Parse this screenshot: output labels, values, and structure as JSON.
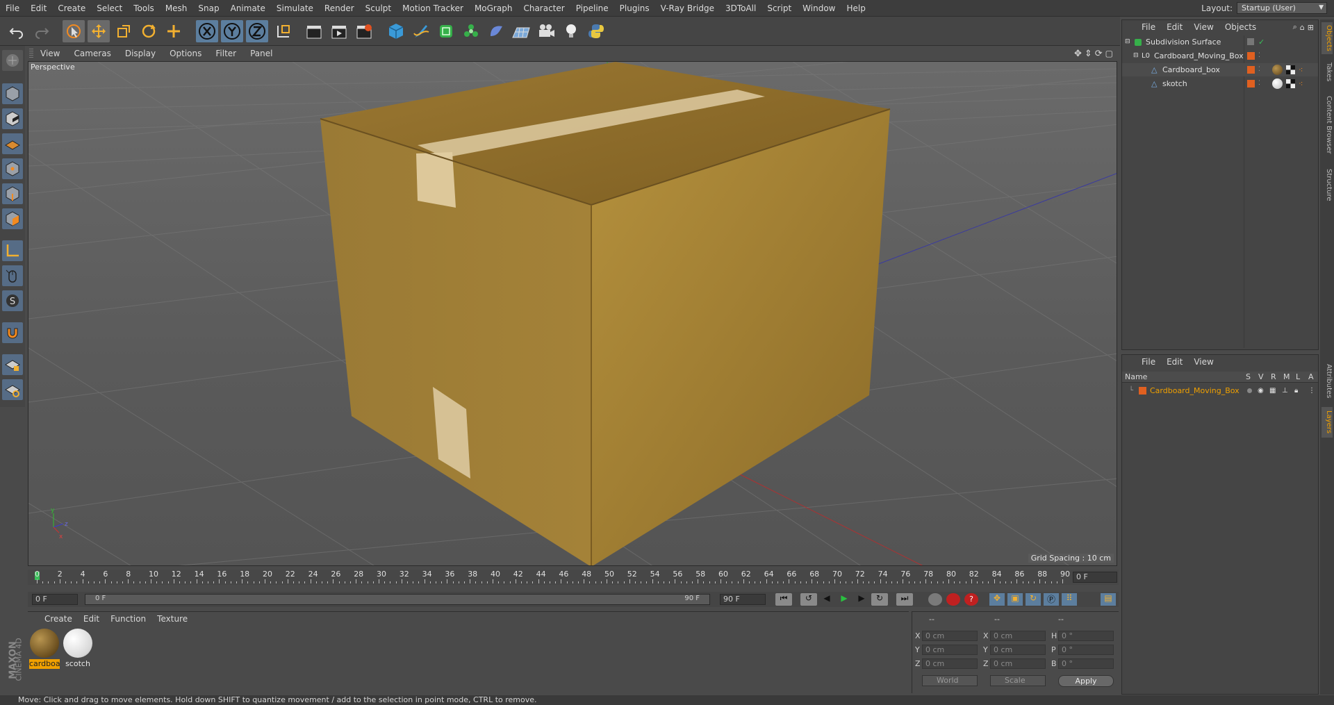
{
  "menubar": {
    "items": [
      "File",
      "Edit",
      "Create",
      "Select",
      "Tools",
      "Mesh",
      "Snap",
      "Animate",
      "Simulate",
      "Render",
      "Sculpt",
      "Motion Tracker",
      "MoGraph",
      "Character",
      "Pipeline",
      "Plugins",
      "V-Ray Bridge",
      "3DToAll",
      "Script",
      "Window",
      "Help"
    ],
    "layout_label": "Layout:",
    "layout_value": "Startup (User)"
  },
  "viewport": {
    "menu": [
      "View",
      "Cameras",
      "Display",
      "Options",
      "Filter",
      "Panel"
    ],
    "camera_label": "Perspective",
    "grid_spacing": "Grid Spacing : 10 cm"
  },
  "timeline": {
    "ticks": [
      "0",
      "2",
      "4",
      "6",
      "8",
      "10",
      "12",
      "14",
      "16",
      "18",
      "20",
      "22",
      "24",
      "26",
      "28",
      "30",
      "32",
      "34",
      "36",
      "38",
      "40",
      "42",
      "44",
      "46",
      "48",
      "50",
      "52",
      "54",
      "56",
      "58",
      "60",
      "62",
      "64",
      "66",
      "68",
      "70",
      "72",
      "74",
      "76",
      "78",
      "80",
      "82",
      "84",
      "86",
      "88",
      "90"
    ],
    "current_frame": "0 F",
    "start_field": "0 F",
    "slider_start": "0 F",
    "slider_end": "90 F",
    "end_field": "90 F"
  },
  "materials": {
    "menu": [
      "Create",
      "Edit",
      "Function",
      "Texture"
    ],
    "items": [
      {
        "label": "cardboa",
        "selected": true,
        "color": "#8a6a2a"
      },
      {
        "label": "scotch",
        "selected": false,
        "color": "#e8e8e8"
      }
    ]
  },
  "coords": {
    "header_dashes": [
      "--",
      "--",
      "--"
    ],
    "rows": [
      {
        "l1": "X",
        "v1": "0 cm",
        "l2": "X",
        "v2": "0 cm",
        "l3": "H",
        "v3": "0 °"
      },
      {
        "l1": "Y",
        "v1": "0 cm",
        "l2": "Y",
        "v2": "0 cm",
        "l3": "P",
        "v3": "0 °"
      },
      {
        "l1": "Z",
        "v1": "0 cm",
        "l2": "Z",
        "v2": "0 cm",
        "l3": "B",
        "v3": "0 °"
      }
    ],
    "mode1": "World",
    "mode2": "Scale",
    "apply": "Apply"
  },
  "objects": {
    "menu": [
      "File",
      "Edit",
      "View",
      "Objects"
    ],
    "tree": [
      "Subdivision Surface",
      "Cardboard_Moving_Box",
      "Cardboard_box",
      "skotch"
    ]
  },
  "layers": {
    "menu": [
      "File",
      "Edit",
      "View"
    ],
    "col_name": "Name",
    "col_flags": [
      "S",
      "V",
      "R",
      "M",
      "L",
      "A"
    ],
    "row": "Cardboard_Moving_Box"
  },
  "right_tabs": [
    "Objects",
    "Takes",
    "Content Browser",
    "Structure",
    "Attributes",
    "Layers"
  ],
  "status": "Move: Click and drag to move elements. Hold down SHIFT to quantize movement / add to the selection in point mode, CTRL to remove.",
  "brand": {
    "maxon": "MAXON",
    "product": "CINEMA 4D"
  }
}
